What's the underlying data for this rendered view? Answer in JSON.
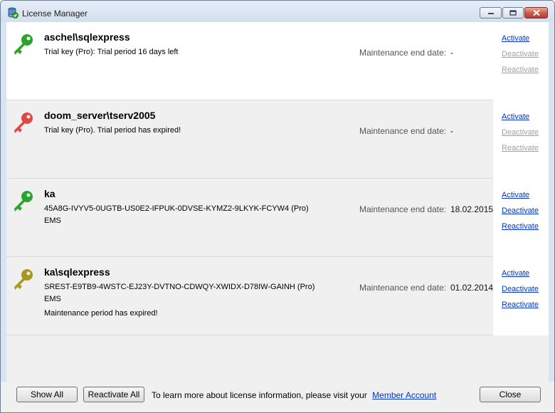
{
  "window": {
    "title": "License Manager"
  },
  "licenses": [
    {
      "name": "aschel\\sqlexpress",
      "lines": [
        "Trial key (Pro): Trial period 16 days left",
        "",
        ""
      ],
      "maint_label": "Maintenance end date:",
      "maint_value": "-",
      "key_color": "#2aa52a",
      "actions": {
        "activate": "Activate",
        "deactivate": "Deactivate",
        "reactivate": "Reactivate"
      }
    },
    {
      "name": "doom_server\\tserv2005",
      "lines": [
        "Trial key (Pro). Trial period has expired!",
        "",
        ""
      ],
      "maint_label": "Maintenance end date:",
      "maint_value": "-",
      "key_color": "#e04848",
      "actions": {
        "activate": "Activate",
        "deactivate": "Deactivate",
        "reactivate": "Reactivate"
      }
    },
    {
      "name": "ka",
      "lines": [
        "45A8G-IVYV5-0UGTB-US0E2-IFPUK-0DVSE-KYMZ2-9LKYK-FCYW4 (Pro)",
        "EMS",
        ""
      ],
      "maint_label": "Maintenance end date:",
      "maint_value": "18.02.2015",
      "key_color": "#2aa52a",
      "actions": {
        "activate": "Activate",
        "deactivate": "Deactivate",
        "reactivate": "Reactivate"
      }
    },
    {
      "name": "ka\\sqlexpress",
      "lines": [
        "SREST-E9TB9-4WSTC-EJ23Y-DVTNO-CDWQY-XWIDX-D78IW-GAINH (Pro)",
        "EMS",
        "Maintenance period has expired!"
      ],
      "maint_label": "Maintenance end date:",
      "maint_value": "01.02.2014",
      "key_color": "#a8981c",
      "actions": {
        "activate": "Activate",
        "deactivate": "Deactivate",
        "reactivate": "Reactivate"
      }
    }
  ],
  "footer": {
    "show_all": "Show All",
    "reactivate_all": "Reactivate All",
    "info_text": "To learn more about license information, please visit your",
    "member_link": "Member Account",
    "close": "Close"
  },
  "icons": {
    "app": "license-manager-app-icon",
    "key": "key-icon"
  }
}
